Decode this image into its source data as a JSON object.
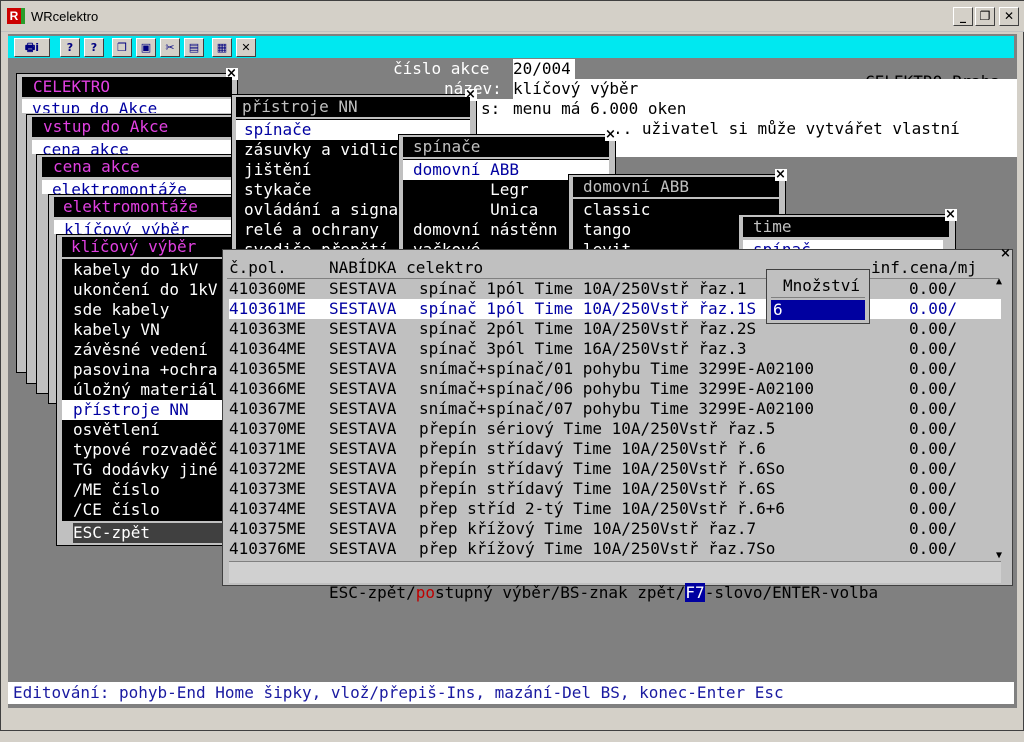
{
  "window": {
    "title": "WRcelektro",
    "app_icon": "R",
    "min_btn": "_",
    "max_btn": "❐",
    "close_btn": "✕"
  },
  "toolbar": {
    "company": "CELEKTRO Praha",
    "buttons": [
      "print-info-icon",
      "help-icon",
      "help2-icon",
      "copy-icon",
      "save-icon",
      "cut-icon",
      "paste-icon",
      "calculator-icon",
      "close-icon"
    ]
  },
  "action": {
    "label_cislo": "číslo akce",
    "cislo": "20/004",
    "label_nazev": "název:",
    "nazev": "klíčový výběr",
    "label_s": "s:",
    "line2": "menu má 6.000 oken",
    "line3": ".. uživatel si může vytvářet vlastní"
  },
  "menus": {
    "m1": {
      "title": "CELEKTRO",
      "item": "vstup do Akce"
    },
    "m2": {
      "title": "vstup do Akce",
      "item": "cena akce"
    },
    "m3": {
      "title": "cena akce",
      "item": "elektromontáže"
    },
    "m4": {
      "title": "elektromontáže",
      "item": "klíčový výběr"
    },
    "m5": {
      "title": "klíčový výběr",
      "items": [
        "kabely do 1kV",
        "ukončení do 1kV",
        "sde kabely",
        "kabely VN",
        "závěsné vedení",
        "pasovina +ochra",
        "úložný materiál",
        "přístroje NN",
        "osvětlení",
        "typové rozvaděč",
        "TG dodávky jiné",
        "/ME číslo",
        "/CE číslo"
      ],
      "selected": 7,
      "footer": "ESC-zpět"
    },
    "m6": {
      "title": "přístroje NN",
      "items": [
        "spínače",
        "zásuvky a vidlic",
        "jištění",
        "stykače",
        "ovládání a signa",
        "relé a ochrany",
        "svodiče přepětí"
      ],
      "selected": 0
    },
    "m7": {
      "title": "spínače",
      "items": [
        "domovní ABB",
        "        Legr",
        "        Unica",
        "domovní nástěnn",
        "vačkové"
      ],
      "selected": 0
    },
    "m8": {
      "title": "domovní ABB",
      "items": [
        "classic",
        "tango",
        "levit"
      ]
    },
    "m9": {
      "title": "time",
      "item": "spínač"
    }
  },
  "table": {
    "col_pol": "č.pol.",
    "col_nab": "NABÍDKA celektro",
    "col_cena": "inf.cena/mj",
    "rows": [
      {
        "pol": "410360ME",
        "typ": "SESTAVA",
        "nazev": "spínač 1pól Time 10A/250Vstř řaz.1",
        "cena": "0.00/"
      },
      {
        "pol": "410361ME",
        "typ": "SESTAVA",
        "nazev": "spínač 1pól Time 10A/250Vstř řaz.1S",
        "cena": "0.00/"
      },
      {
        "pol": "410363ME",
        "typ": "SESTAVA",
        "nazev": "spínač 2pól Time 10A/250Vstř řaz.2S",
        "cena": "0.00/"
      },
      {
        "pol": "410364ME",
        "typ": "SESTAVA",
        "nazev": "spínač 3pól Time 16A/250Vstř řaz.3",
        "cena": "0.00/"
      },
      {
        "pol": "410365ME",
        "typ": "SESTAVA",
        "nazev": "snímač+spínač/01 pohybu Time 3299E-A02100",
        "cena": "0.00/"
      },
      {
        "pol": "410366ME",
        "typ": "SESTAVA",
        "nazev": "snímač+spínač/06 pohybu Time 3299E-A02100",
        "cena": "0.00/"
      },
      {
        "pol": "410367ME",
        "typ": "SESTAVA",
        "nazev": "snímač+spínač/07 pohybu Time 3299E-A02100",
        "cena": "0.00/"
      },
      {
        "pol": "410370ME",
        "typ": "SESTAVA",
        "nazev": "přepín sériový Time 10A/250Vstř řaz.5",
        "cena": "0.00/"
      },
      {
        "pol": "410371ME",
        "typ": "SESTAVA",
        "nazev": "přepín střídavý Time 10A/250Vstř ř.6",
        "cena": "0.00/"
      },
      {
        "pol": "410372ME",
        "typ": "SESTAVA",
        "nazev": "přepín střídavý Time 10A/250Vstř ř.6So",
        "cena": "0.00/"
      },
      {
        "pol": "410373ME",
        "typ": "SESTAVA",
        "nazev": "přepín střídavý Time 10A/250Vstř ř.6S",
        "cena": "0.00/"
      },
      {
        "pol": "410374ME",
        "typ": "SESTAVA",
        "nazev": "přep stříd 2-tý Time 10A/250Vstř ř.6+6",
        "cena": "0.00/"
      },
      {
        "pol": "410375ME",
        "typ": "SESTAVA",
        "nazev": "přep křížový Time 10A/250Vstř řaz.7",
        "cena": "0.00/"
      },
      {
        "pol": "410376ME",
        "typ": "SESTAVA",
        "nazev": "přep křížový Time 10A/250Vstř řaz.7So",
        "cena": "0.00/"
      }
    ],
    "selected": 1,
    "footer_a": "ESC-zpět/",
    "footer_b": "po",
    "footer_c": "stupný výběr/BS-znak zpět/",
    "footer_d": "F7",
    "footer_e": "-slovo/ENTER-volba"
  },
  "qty": {
    "label": "Množství",
    "value": "6"
  },
  "status": "Editování: pohyb-End Home šipky, vlož/přepiš-Ins, mazání-Del BS, konec-Enter Esc",
  "colors": {
    "highlight_blue": "#0000a0",
    "menu_title": "#e040e0",
    "toolbar_cyan": "#00e8f0"
  }
}
